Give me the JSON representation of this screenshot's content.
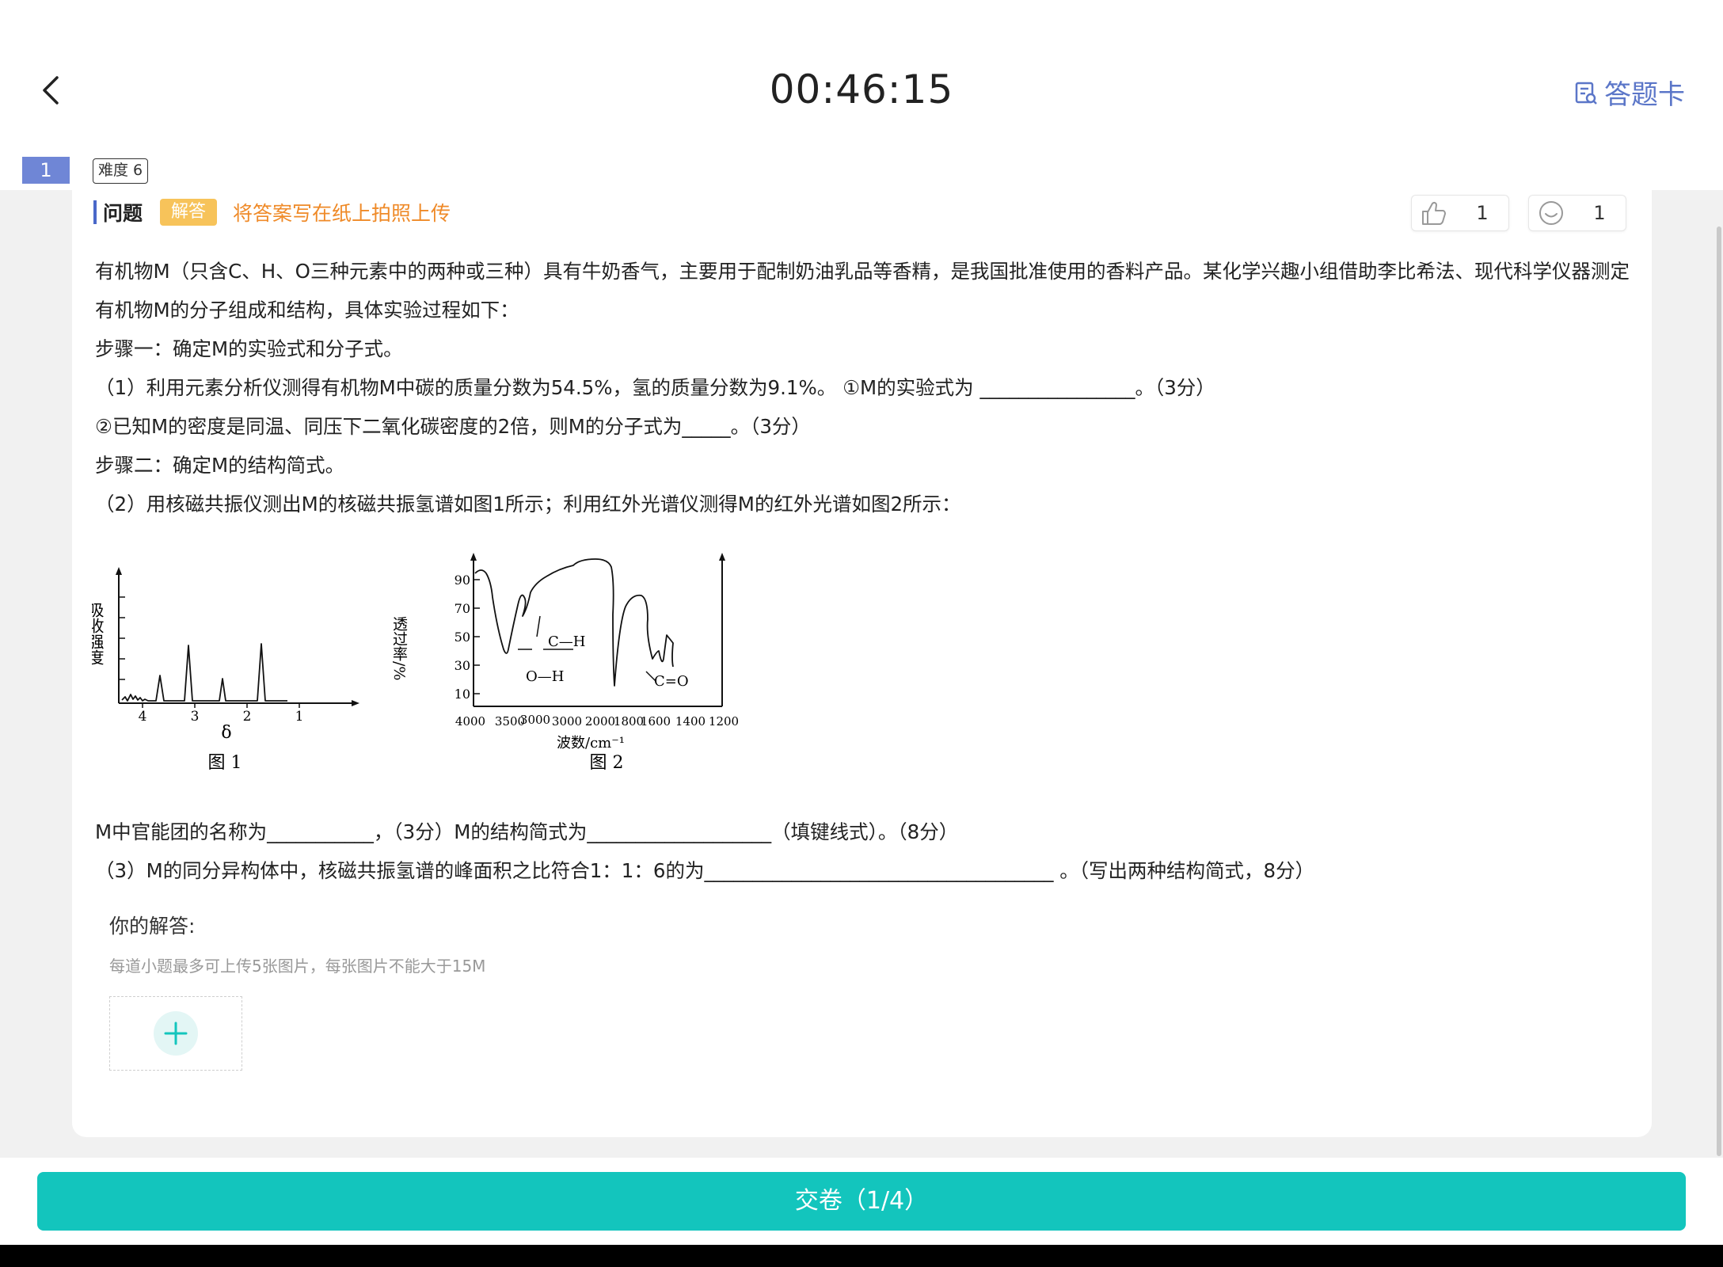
{
  "header": {
    "timer": "00:46:15",
    "answer_card_label": "答题卡",
    "question_number": "1",
    "difficulty": "难度 6"
  },
  "question": {
    "title": "问题",
    "type_badge": "解答",
    "tip": "将答案写在纸上拍照上传",
    "likes": "1",
    "smiles": "1",
    "lines": [
      "有机物M（只含C、H、O三种元素中的两种或三种）具有牛奶香气，主要用于配制奶油乳品等香精，是我国批准使用的香料产品。某化学兴趣小组借助李比希法、现代科学仪器测定",
      "有机物M的分子组成和结构，具体实验过程如下：",
      "步骤一：确定M的实验式和分子式。",
      "（1）利用元素分析仪测得有机物M中碳的质量分数为54.5%，氢的质量分数为9.1%。 ①M的实验式为 ________________。（3分）",
      "②已知M的密度是同温、同压下二氧化碳密度的2倍，则M的分子式为_____。（3分）",
      "步骤二：确定M的结构简式。",
      "（2）用核磁共振仪测出M的核磁共振氢谱如图1所示；利用红外光谱仪测得M的红外光谱如图2所示："
    ],
    "lines_after": [
      "M中官能团的名称为___________，（3分）M的结构简式为___________________（填键线式）。（8分）",
      "（3）M的同分异构体中，核磁共振氢谱的峰面积之比符合1：1：6的为____________________________________ 。（写出两种结构简式，8分）"
    ]
  },
  "figure1": {
    "ylabel": "吸收强度",
    "xlabel": "δ",
    "ticks": [
      "4",
      "3",
      "2",
      "1"
    ],
    "caption": "图 1"
  },
  "figure2": {
    "ylabel": "透过率/%",
    "yticks": [
      "90",
      "70",
      "50",
      "30",
      "10"
    ],
    "xticks": [
      "4000",
      "3500",
      "3000",
      "3000",
      "2000",
      "1800",
      "1600",
      "1400",
      "1200"
    ],
    "xlabel": "波数/cm⁻¹",
    "labels": [
      "C—H",
      "O—H",
      "C=O"
    ],
    "caption": "图 2"
  },
  "answer": {
    "label": "你的解答:",
    "upload_tip": "每道小题最多可上传5张图片，每张图片不能大于15M"
  },
  "submit_label": "交卷（1/4）",
  "colors": {
    "accent": "#13c5bd",
    "badge": "#f7c35a",
    "tip": "#ef8a28",
    "link": "#5b76c8"
  }
}
